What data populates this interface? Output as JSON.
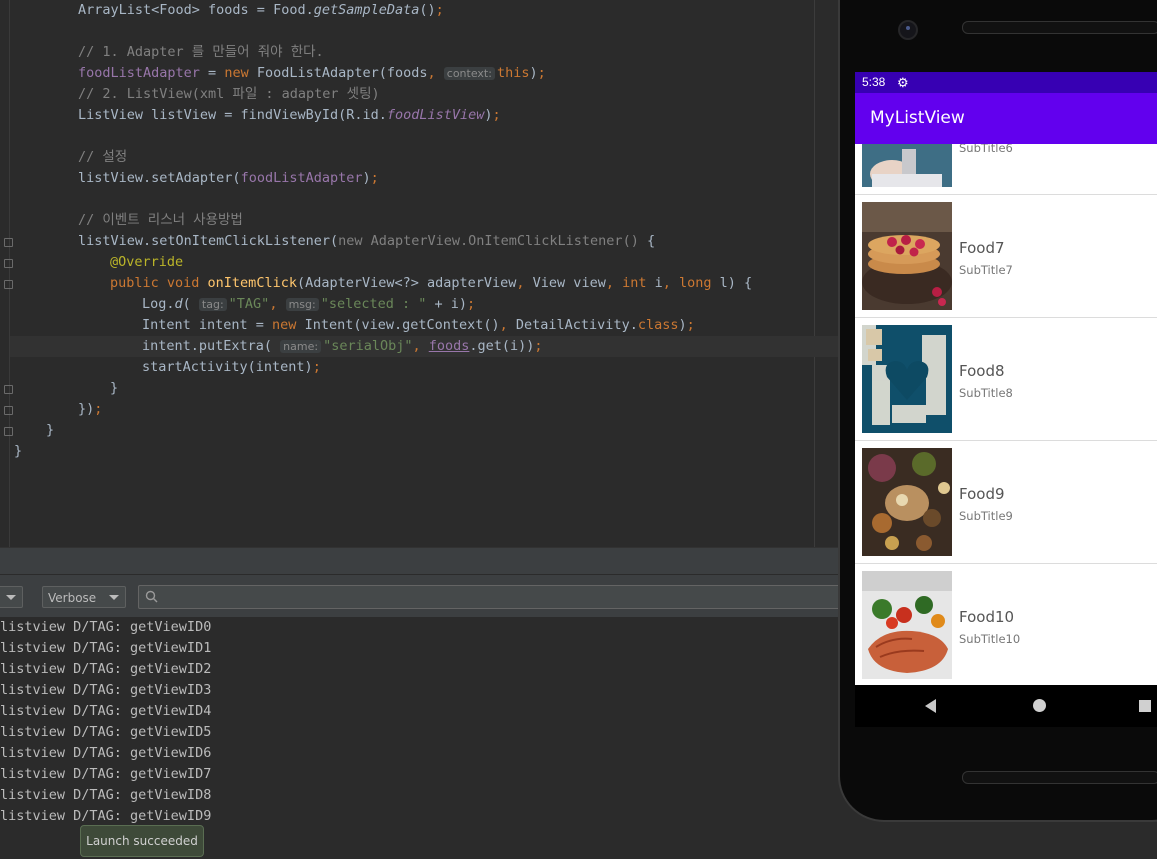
{
  "editor": {
    "lines": [
      {
        "indent": 78,
        "parts": [
          [
            "t",
            "ArrayList<Food> foods = Food."
          ],
          [
            "it",
            "getSampleData"
          ],
          [
            "t",
            "()"
          ],
          [
            "kw",
            ";"
          ]
        ]
      },
      {
        "indent": 78,
        "parts": []
      },
      {
        "indent": 78,
        "parts": [
          [
            "cm",
            "// 1. Adapter 를 만들어 줘야 한다."
          ]
        ]
      },
      {
        "indent": 78,
        "parts": [
          [
            "fld",
            "foodListAdapter"
          ],
          [
            "t",
            " = "
          ],
          [
            "kw",
            "new "
          ],
          [
            "t",
            "FoodListAdapter(foods"
          ],
          [
            "kw",
            ", "
          ],
          [
            "hint",
            "context:"
          ],
          [
            "kw",
            "this"
          ],
          [
            "t",
            ")"
          ],
          [
            "kw",
            ";"
          ]
        ]
      },
      {
        "indent": 78,
        "parts": [
          [
            "cm",
            "// 2. ListView(xml 파일 : adapter 셋팅)"
          ]
        ]
      },
      {
        "indent": 78,
        "parts": [
          [
            "t",
            "ListView listView = findViewById(R.id."
          ],
          [
            "fldit",
            "foodListView"
          ],
          [
            "t",
            ")"
          ],
          [
            "kw",
            ";"
          ]
        ]
      },
      {
        "indent": 78,
        "parts": []
      },
      {
        "indent": 78,
        "parts": [
          [
            "cm",
            "// 설정"
          ]
        ]
      },
      {
        "indent": 78,
        "parts": [
          [
            "t",
            "listView.setAdapter("
          ],
          [
            "fld",
            "foodListAdapter"
          ],
          [
            "t",
            ")"
          ],
          [
            "kw",
            ";"
          ]
        ]
      },
      {
        "indent": 78,
        "parts": []
      },
      {
        "indent": 78,
        "parts": [
          [
            "cm",
            "// 이벤트 리스너 사용방법"
          ]
        ]
      },
      {
        "indent": 78,
        "parts": [
          [
            "t",
            "listView.setOnItemClickListener("
          ],
          [
            "cm",
            "new AdapterView.OnItemClickListener() "
          ],
          [
            "t",
            "{"
          ]
        ]
      },
      {
        "indent": 110,
        "parts": [
          [
            "ann",
            "@Override"
          ]
        ]
      },
      {
        "indent": 110,
        "parts": [
          [
            "kw",
            "public void "
          ],
          [
            "fn",
            "onItemClick"
          ],
          [
            "t",
            "(AdapterView<?> adapterView"
          ],
          [
            "kw",
            ", "
          ],
          [
            "t",
            "View view"
          ],
          [
            "kw",
            ", int "
          ],
          [
            "t",
            "i"
          ],
          [
            "kw",
            ", long "
          ],
          [
            "t",
            "l) {"
          ]
        ]
      },
      {
        "indent": 142,
        "parts": [
          [
            "t",
            "Log."
          ],
          [
            "it",
            "d"
          ],
          [
            "t",
            "( "
          ],
          [
            "hint",
            "tag:"
          ],
          [
            "str",
            "\"TAG\""
          ],
          [
            "kw",
            ", "
          ],
          [
            "hint",
            "msg:"
          ],
          [
            "str",
            "\"selected : \""
          ],
          [
            "t",
            " + i)"
          ],
          [
            "kw",
            ";"
          ]
        ]
      },
      {
        "indent": 142,
        "parts": [
          [
            "t",
            "Intent intent = "
          ],
          [
            "kw",
            "new "
          ],
          [
            "t",
            "Intent(view.getContext()"
          ],
          [
            "kw",
            ", "
          ],
          [
            "t",
            "DetailActivity."
          ],
          [
            "kw",
            "class"
          ],
          [
            "t",
            ")"
          ],
          [
            "kw",
            ";"
          ]
        ]
      },
      {
        "indent": 142,
        "parts": [
          [
            "t",
            "intent.putExtra( "
          ],
          [
            "hint",
            "name:"
          ],
          [
            "str",
            "\"serialObj\""
          ],
          [
            "kw",
            ", "
          ],
          [
            "fldul",
            "foods"
          ],
          [
            "t",
            ".get(i))"
          ],
          [
            "kw",
            ";"
          ]
        ]
      },
      {
        "indent": 142,
        "parts": [
          [
            "t",
            "startActivity(intent)"
          ],
          [
            "kw",
            ";"
          ]
        ]
      },
      {
        "indent": 110,
        "parts": [
          [
            "t",
            "}"
          ]
        ]
      },
      {
        "indent": 78,
        "parts": [
          [
            "t",
            "})"
          ],
          [
            "kw",
            ";"
          ]
        ]
      },
      {
        "indent": 46,
        "parts": [
          [
            "t",
            "}"
          ]
        ]
      },
      {
        "indent": 14,
        "parts": [
          [
            "t",
            "}"
          ]
        ]
      }
    ]
  },
  "logcat": {
    "filter_value": "",
    "level_value": "Verbose",
    "lines": [
      "listview D/TAG: getViewID0",
      "listview D/TAG: getViewID1",
      "listview D/TAG: getViewID2",
      "listview D/TAG: getViewID3",
      "listview D/TAG: getViewID4",
      "listview D/TAG: getViewID5",
      "listview D/TAG: getViewID6",
      "listview D/TAG: getViewID7",
      "listview D/TAG: getViewID8",
      "listview D/TAG: getViewID9"
    ]
  },
  "toast": {
    "text": "Launch succeeded"
  },
  "phone": {
    "status_time": "5:38",
    "app_title": "MyListView",
    "partial_item_subtitle": "SubTitle6",
    "items": [
      {
        "title": "Food7",
        "subtitle": "SubTitle7",
        "image": "pancakes-raspberries"
      },
      {
        "title": "Food8",
        "subtitle": "SubTitle8",
        "image": "heart-in-sugar"
      },
      {
        "title": "Food9",
        "subtitle": "SubTitle9",
        "image": "food-table-spread"
      },
      {
        "title": "Food10",
        "subtitle": "SubTitle10",
        "image": "salmon-steak-salad"
      }
    ],
    "colors": {
      "status_bar": "#3700b3",
      "app_bar": "#6200ee"
    }
  }
}
